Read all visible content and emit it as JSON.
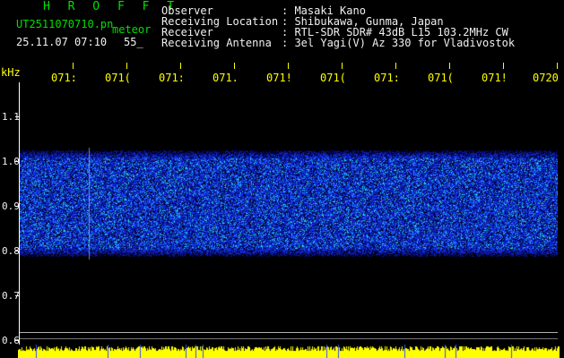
{
  "header": {
    "brand": "H R O F F T",
    "filename": "UT2511070710.pn",
    "meteor_label": "meteor",
    "datetime": "25.11.07 07:10",
    "count": "55_"
  },
  "info": [
    {
      "label": "Observer",
      "value": ": Masaki Kano"
    },
    {
      "label": "Receiving Location",
      "value": ": Shibukawa, Gunma, Japan"
    },
    {
      "label": "Receiver",
      "value": ": RTL-SDR SDR# 43dB L15 103.2MHz CW"
    },
    {
      "label": "Receiving Antenna",
      "value": ": 3el Yagi(V) Az 330 for Vladivostok"
    }
  ],
  "axis": {
    "unit": "kHz",
    "y_labels": [
      "1.1",
      "1.0",
      "0.9",
      "0.8",
      "0.7",
      "0.6"
    ],
    "x_labels": [
      "071:",
      "071(",
      "071:",
      "071.",
      "071!",
      "071(",
      "071:",
      "071(",
      "071!",
      "0720"
    ]
  },
  "colors": {
    "background": "#000000",
    "header_green": "#00e000",
    "text_white": "#f0f0f0",
    "time_yellow": "#ffff00",
    "noise_blue": "#1030ff"
  }
}
